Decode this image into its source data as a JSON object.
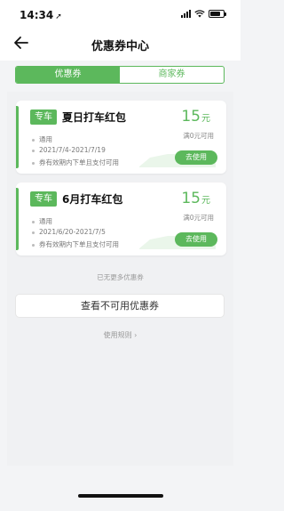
{
  "status": {
    "time": "14:34",
    "location_icon": "location-arrow-icon"
  },
  "nav": {
    "title": "优惠券中心",
    "back_icon": "back-arrow-icon"
  },
  "tabs": [
    {
      "label": "优惠券",
      "active": true
    },
    {
      "label": "商家券",
      "active": false
    }
  ],
  "coupons": [
    {
      "tag": "专车",
      "title": "夏日打车红包",
      "amount": "15",
      "unit": "元",
      "threshold": "满0元可用",
      "scope": "通用",
      "validity": "2021/7/4-2021/7/19",
      "note": "券有效期内下单且支付可用",
      "button": "去使用"
    },
    {
      "tag": "专车",
      "title": "6月打车红包",
      "amount": "15",
      "unit": "元",
      "threshold": "满0元可用",
      "scope": "通用",
      "validity": "2021/6/20-2021/7/5",
      "note": "券有效期内下单且支付可用",
      "button": "去使用"
    }
  ],
  "no_more": "已无更多优惠券",
  "unavailable_button": "查看不可用优惠券",
  "rules_link": "使用规则",
  "rules_chevron": "›",
  "colors": {
    "accent": "#5cb85c",
    "background": "#f3f4f6"
  }
}
